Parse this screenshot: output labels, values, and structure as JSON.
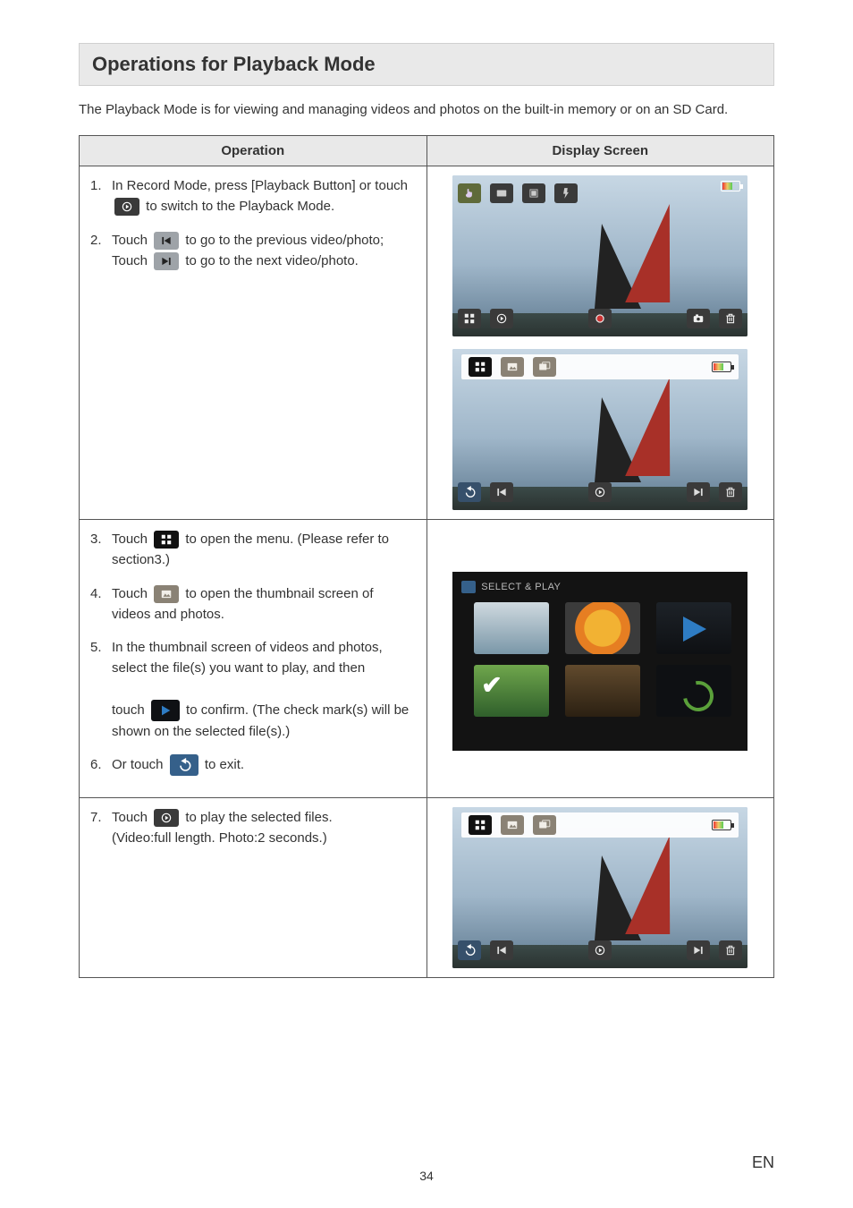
{
  "section_title": "Operations for Playback Mode",
  "intro": "The Playback Mode is for viewing and managing videos and photos on the built-in memory or on an SD Card.",
  "table": {
    "col_operation": "Operation",
    "col_display": "Display Screen"
  },
  "steps": {
    "s1": {
      "num": "1.",
      "a": "In Record Mode, press [Playback Button] or touch",
      "b": "to switch to the Playback Mode."
    },
    "s2": {
      "num": "2.",
      "a": "Touch",
      "b": "to go to the previous video/photo;",
      "c": "Touch",
      "d": "to go to the next video/photo."
    },
    "s3": {
      "num": "3.",
      "a": "Touch",
      "b": "to open the menu. (Please refer to section3.)"
    },
    "s4": {
      "num": "4.",
      "a": "Touch",
      "b": "to open the thumbnail screen of videos and photos."
    },
    "s5": {
      "num": "5.",
      "a": "In the thumbnail screen of videos and photos, select the file(s) you want to play, and then",
      "b": "touch",
      "c": "to confirm. (The check mark(s) will be shown on the selected file(s).)"
    },
    "s6": {
      "num": "6.",
      "a": "Or touch",
      "b": "to exit."
    },
    "s7": {
      "num": "7.",
      "a": "Touch",
      "b": "to play the selected files.",
      "c": "(Video:full length. Photo:2 seconds.)"
    }
  },
  "select_play_label": "SELECT & PLAY",
  "page_number": "34",
  "lang": "EN"
}
